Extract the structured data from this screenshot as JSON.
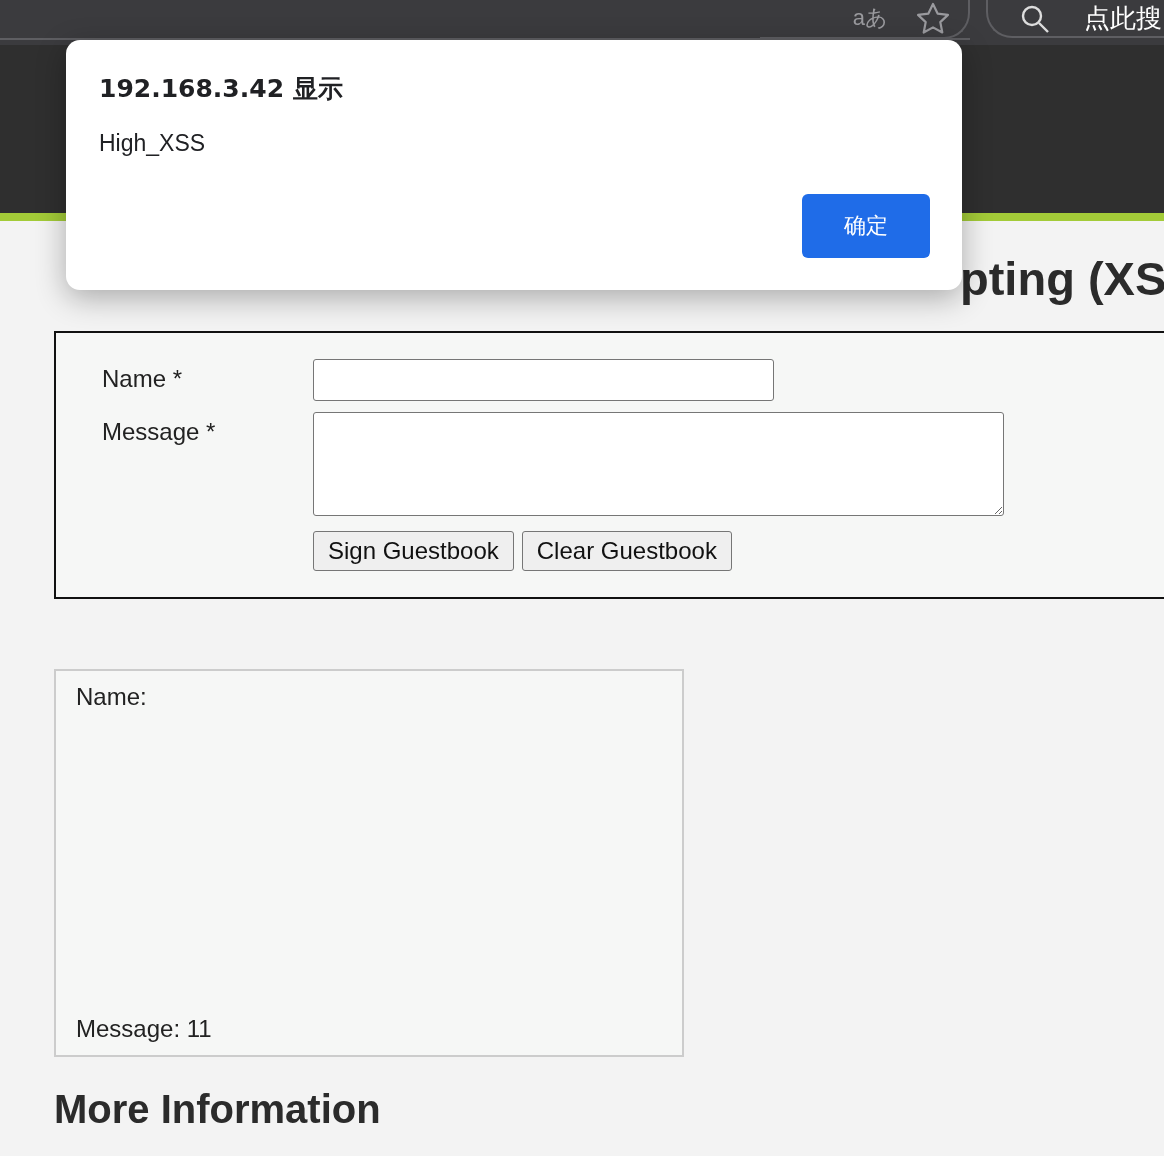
{
  "browser_toolbar": {
    "translate_label": "aあ",
    "search": {
      "placeholder": "点此搜"
    }
  },
  "page": {
    "heading": "pting (XS",
    "form": {
      "fields": [
        {
          "label": "Name *",
          "kind": "input"
        },
        {
          "label": "Message *",
          "kind": "textarea"
        }
      ],
      "buttons": [
        "Sign Guestbook",
        "Clear Guestbook"
      ]
    },
    "entries": [
      {
        "name_label": "Name:",
        "message_label": "Message: 11"
      }
    ],
    "more_heading": "More Information"
  },
  "dialog": {
    "title": "192.168.3.42 显示",
    "message": "High_XSS",
    "button": "确定"
  }
}
